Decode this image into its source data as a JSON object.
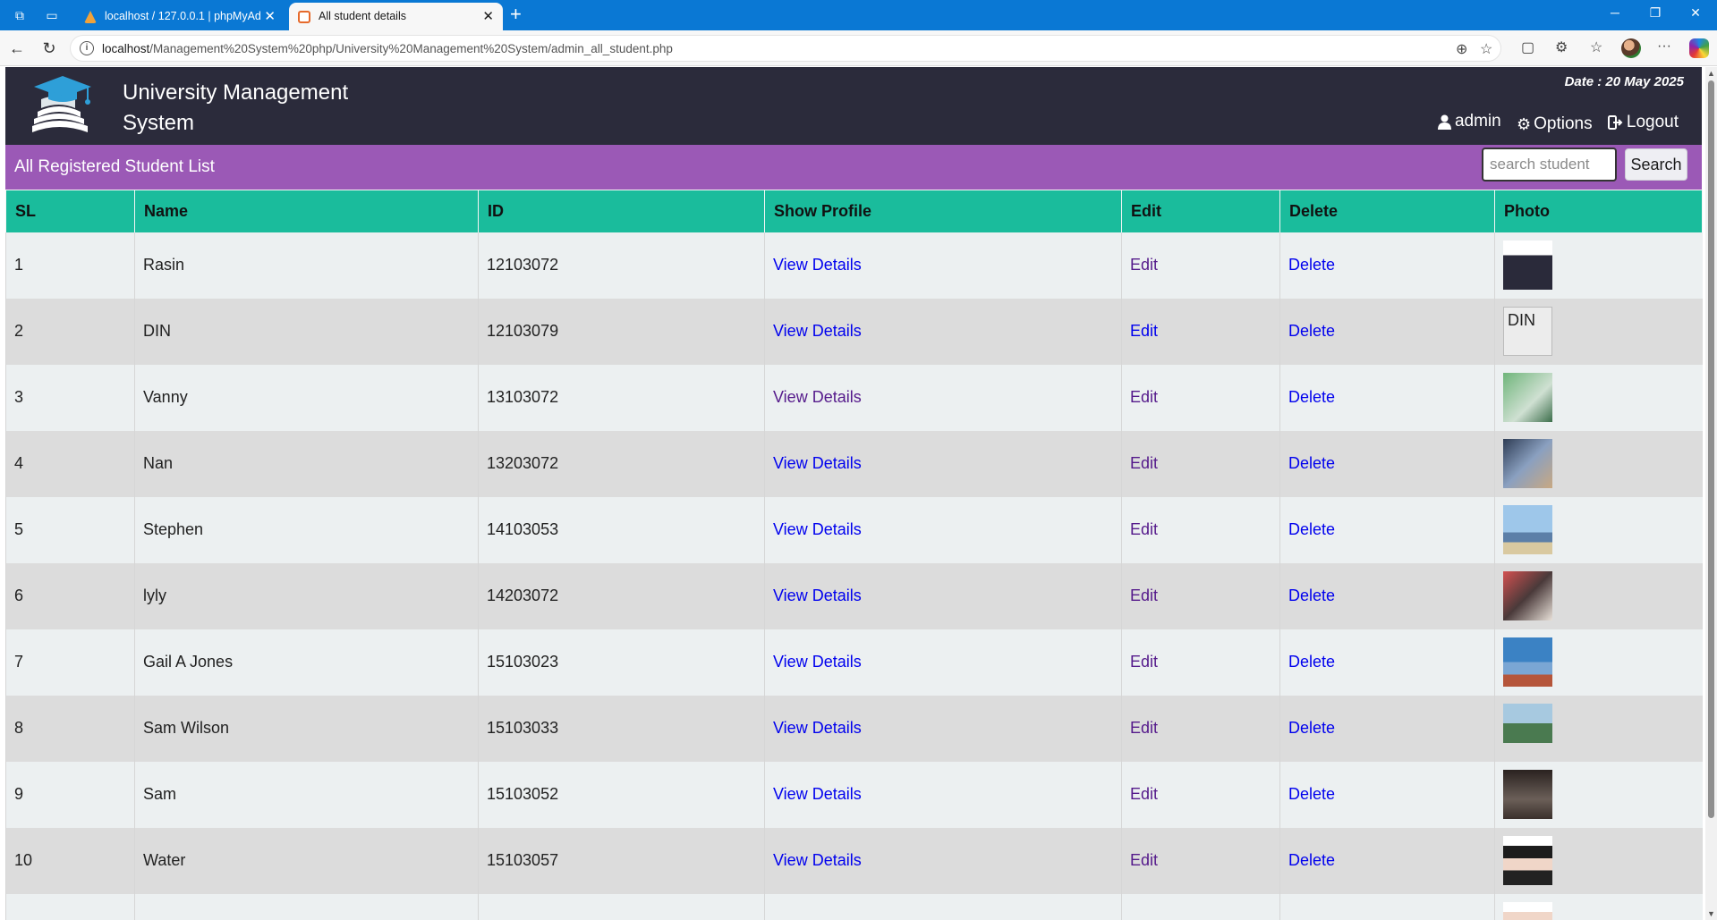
{
  "browser": {
    "tabs": [
      {
        "title": "localhost / 127.0.0.1 | phpMyAdmin",
        "active": false
      },
      {
        "title": "All student details",
        "active": true
      }
    ],
    "url_host": "localhost",
    "url_path": "/Management%20System%20php/University%20Management%20System/admin_all_student.php"
  },
  "header": {
    "title": "University Management System",
    "date_label": "Date :",
    "date_value": "20 May 2025",
    "menu": {
      "admin": "admin",
      "options": "Options",
      "logout": "Logout"
    }
  },
  "list": {
    "title": "All Registered Student List",
    "search_placeholder": "search student",
    "search_button": "Search"
  },
  "table": {
    "columns": [
      "SL",
      "Name",
      "ID",
      "Show Profile",
      "Edit",
      "Delete",
      "Photo"
    ],
    "rows": [
      {
        "sl": "1",
        "name": "Rasin",
        "id": "12103072",
        "profile": "View Details",
        "edit": "Edit",
        "delete": "Delete",
        "photo_alt": ""
      },
      {
        "sl": "2",
        "name": "DIN",
        "id": "12103079",
        "profile": "View Details",
        "edit": "Edit",
        "delete": "Delete",
        "photo_alt": "DIN"
      },
      {
        "sl": "3",
        "name": "Vanny",
        "id": "13103072",
        "profile": "View Details",
        "edit": "Edit",
        "delete": "Delete",
        "photo_alt": ""
      },
      {
        "sl": "4",
        "name": "Nan",
        "id": "13203072",
        "profile": "View Details",
        "edit": "Edit",
        "delete": "Delete",
        "photo_alt": ""
      },
      {
        "sl": "5",
        "name": "Stephen",
        "id": "14103053",
        "profile": "View Details",
        "edit": "Edit",
        "delete": "Delete",
        "photo_alt": ""
      },
      {
        "sl": "6",
        "name": "lyly",
        "id": "14203072",
        "profile": "View Details",
        "edit": "Edit",
        "delete": "Delete",
        "photo_alt": ""
      },
      {
        "sl": "7",
        "name": "Gail A Jones",
        "id": "15103023",
        "profile": "View Details",
        "edit": "Edit",
        "delete": "Delete",
        "photo_alt": ""
      },
      {
        "sl": "8",
        "name": "Sam Wilson",
        "id": "15103033",
        "profile": "View Details",
        "edit": "Edit",
        "delete": "Delete",
        "photo_alt": ""
      },
      {
        "sl": "9",
        "name": "Sam",
        "id": "15103052",
        "profile": "View Details",
        "edit": "Edit",
        "delete": "Delete",
        "photo_alt": ""
      },
      {
        "sl": "10",
        "name": "Water",
        "id": "15103057",
        "profile": "View Details",
        "edit": "Edit",
        "delete": "Delete",
        "photo_alt": ""
      }
    ]
  },
  "colors": {
    "header_bg": "#2b2b3b",
    "list_bar_bg": "#9b59b6",
    "table_header_bg": "#1abc9c",
    "row_odd_bg": "#ecf0f1",
    "row_even_bg": "#dcdcdc",
    "link": "#0000ee",
    "visited_link": "#551a8b"
  }
}
